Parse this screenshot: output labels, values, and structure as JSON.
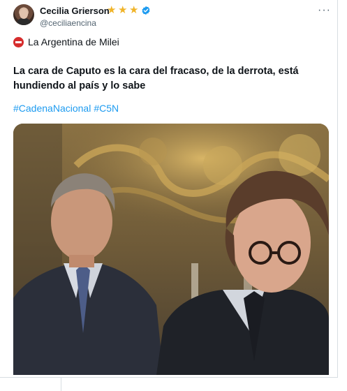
{
  "post": {
    "display_name": "Cecilia Grierson",
    "handle": "@ceciliaencina",
    "stars": [
      "★",
      "★",
      "★"
    ],
    "more_label": "···",
    "badge_text": "La Argentina de Milei",
    "body": "La cara de Caputo es la cara del fracaso, de la derrota, está hundiendo al país y lo sabe",
    "hashtags": [
      "#CadenaNacional",
      "#C5N"
    ]
  },
  "icons": {
    "avatar": "profile-photo",
    "verified": "verified-badge-icon",
    "badge": "no-entry-icon",
    "media": "video-still"
  },
  "colors": {
    "link": "#1d9bf0",
    "verified": "#1d9bf0",
    "star": "#f0b429",
    "badge_red": "#d62d2d",
    "secondary_text": "#536471"
  }
}
